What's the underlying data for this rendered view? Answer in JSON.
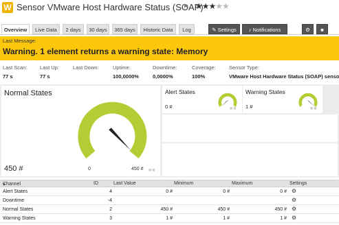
{
  "header": {
    "logo": "W",
    "title": "Sensor VMware Host Hardware Status (SOAP)",
    "rating": 3,
    "rating_max": 5
  },
  "tabs": [
    {
      "label": "Overview",
      "active": true
    },
    {
      "label": "Live Data"
    },
    {
      "label": "2 days"
    },
    {
      "label": "30 days"
    },
    {
      "label": "365 days"
    },
    {
      "label": "Historic Data"
    },
    {
      "label": "Log"
    },
    {
      "label": "Settings",
      "icon": "wrench-icon"
    },
    {
      "label": "Notifications",
      "icon": "bell-icon"
    },
    {
      "label": "",
      "icon": "settings-icon"
    },
    {
      "label": "",
      "icon": "delete-icon"
    }
  ],
  "message": {
    "label": "Last Message:",
    "text": "Warning. 1 element returns a warning state: Memory",
    "color": "#fdc70c"
  },
  "stats": [
    {
      "label": "Last Scan:",
      "value": "77 s"
    },
    {
      "label": "Last Up:",
      "value": "77 s"
    },
    {
      "label": "Last Down:",
      "value": ""
    },
    {
      "label": "Uptime:",
      "value": "100,0000%"
    },
    {
      "label": "Downtime:",
      "value": "0,0000%"
    },
    {
      "label": "Coverage:",
      "value": "100%"
    },
    {
      "label": "Sensor Type:",
      "value": "VMware Host Hardware Status (SOAP) sensor"
    }
  ],
  "gauges": {
    "normal": {
      "title": "Normal States",
      "value": "450 #",
      "min_label": "0",
      "max_label": "450 #",
      "fraction": 1.0
    },
    "alert": {
      "title": "Alert States",
      "value": "0 #",
      "fraction": 0.0
    },
    "warning": {
      "title": "Warning States",
      "value": "1 #",
      "fraction": 1.0
    },
    "gauge_color": "#b5cc34"
  },
  "table": {
    "headers": [
      "Channel",
      "ID",
      "Last Value",
      "Minimum",
      "Maximum",
      "Settings"
    ],
    "rows": [
      {
        "channel": "Alert States",
        "id": "4",
        "last": "0 #",
        "min": "0 #",
        "max": "0 #"
      },
      {
        "channel": "Downtime",
        "id": "-4",
        "last": "",
        "min": "",
        "max": ""
      },
      {
        "channel": "Normal States",
        "id": "2",
        "last": "450 #",
        "min": "450 #",
        "max": "450 #"
      },
      {
        "channel": "Warning States",
        "id": "3",
        "last": "1 #",
        "min": "1 #",
        "max": "1 #"
      }
    ]
  }
}
